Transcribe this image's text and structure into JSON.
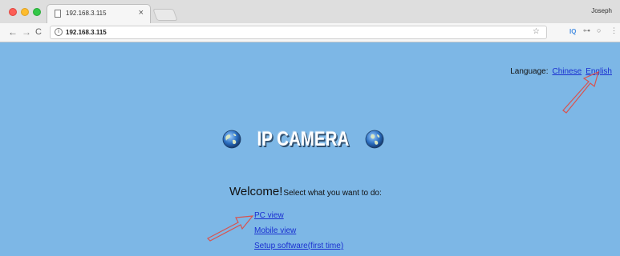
{
  "browser": {
    "tab_title": "192.168.3.115",
    "tab_close": "×",
    "profile_name": "Joseph",
    "url": "192.168.3.115",
    "extension_label": "IQ"
  },
  "page": {
    "language_label": "Language:",
    "languages": [
      "Chinese",
      "English"
    ],
    "logo_text": "IP CAMERA",
    "welcome_big": "Welcome!",
    "welcome_small": "Select what you want to do:",
    "links": [
      "PC view",
      "Mobile view",
      "Setup software(first time)"
    ]
  },
  "colors": {
    "page_background": "#7db7e6",
    "link": "#1a2fd0",
    "annotation_arrow": "#d9534f"
  }
}
